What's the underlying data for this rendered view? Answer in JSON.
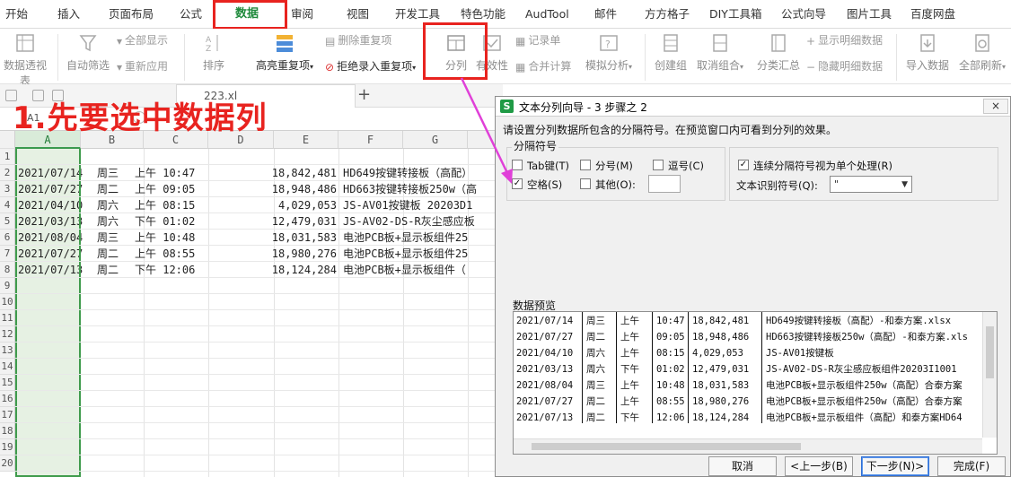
{
  "tabs": [
    "开始",
    "插入",
    "页面布局",
    "公式",
    "数据",
    "审阅",
    "视图",
    "开发工具",
    "特色功能",
    "AudTool",
    "邮件",
    "方方格子",
    "DIY工具箱",
    "公式向导",
    "图片工具",
    "百度网盘"
  ],
  "ribbon": {
    "pivot": "数据透视表",
    "autofilter": "自动筛选",
    "show_all": "全部显示",
    "reapply": "重新应用",
    "sort": "排序",
    "highlight_dup": "高亮重复项",
    "delete_dup": "删除重复项",
    "reject_dup": "拒绝录入重复项",
    "split": "分列",
    "validity": "有效性",
    "record": "记录单",
    "merge_calc": "合并计算",
    "simulate": "模拟分析",
    "create_group": "创建组",
    "ungroup": "取消组合",
    "subtotal": "分类汇总",
    "show_detail": "显示明细数据",
    "hide_detail": "隐藏明细数据",
    "import": "导入数据",
    "refresh_all": "全部刷新"
  },
  "quickbar": {
    "doc_name": "223.xl"
  },
  "namebox": "A1",
  "annotation": "1.先要选中数据列",
  "grid": {
    "columns": [
      "A",
      "B",
      "C",
      "D",
      "E",
      "F",
      "G"
    ],
    "rows": [
      "1",
      "2",
      "3",
      "4",
      "5",
      "6",
      "7",
      "8",
      "9",
      "10",
      "11",
      "12",
      "13",
      "14",
      "15",
      "16",
      "17",
      "18",
      "19",
      "20"
    ],
    "data": [
      [
        "2021/07/14",
        "周三",
        "上午 10:47",
        "18,842,481",
        "HD649按键转接板（高配）"
      ],
      [
        "2021/07/27",
        "周二",
        "上午 09:05",
        "18,948,486",
        "HD663按键转接板250w（高"
      ],
      [
        "2021/04/10",
        "周六",
        "上午 08:15",
        "4,029,053",
        "JS-AV01按键板   20203D1"
      ],
      [
        "2021/03/13",
        "周六",
        "下午 01:02",
        "12,479,031",
        "JS-AV02-DS-R灰尘感应板"
      ],
      [
        "2021/08/04",
        "周三",
        "上午 10:48",
        "18,031,583",
        "电池PCB板+显示板组件25"
      ],
      [
        "2021/07/27",
        "周二",
        "上午 08:55",
        "18,980,276",
        "电池PCB板+显示板组件25"
      ],
      [
        "2021/07/13",
        "周二",
        "下午 12:06",
        "18,124,284",
        "电池PCB板+显示板组件（"
      ]
    ]
  },
  "dialog": {
    "logo": "S",
    "title": "文本分列向导 - 3 步骤之 2",
    "close": "×",
    "instruction": "请设置分列数据所包含的分隔符号。在预览窗口内可看到分列的效果。",
    "group_label": "分隔符号",
    "tab": "Tab键(T)",
    "semicolon": "分号(M)",
    "comma": "逗号(C)",
    "space": "空格(S)",
    "other": "其他(O):",
    "consecutive": "连续分隔符号视为单个处理(R)",
    "text_qualifier_label": "文本识别符号(Q):",
    "text_qualifier_value": "\"",
    "preview_label": "数据预览",
    "preview_rows": [
      [
        "2021/07/14",
        "周三",
        "上午",
        "10:47",
        "18,842,481",
        "HD649按键转接板（高配）-和泰方案.xlsx"
      ],
      [
        "2021/07/27",
        "周二",
        "上午",
        "09:05",
        "18,948,486",
        "HD663按键转接板250w（高配）-和泰方案.xls"
      ],
      [
        "2021/04/10",
        "周六",
        "上午",
        "08:15",
        "4,029,053",
        "JS-AV01按键板"
      ],
      [
        "2021/03/13",
        "周六",
        "下午",
        "01:02",
        "12,479,031",
        "JS-AV02-DS-R灰尘感应板组件20203I1001"
      ],
      [
        "2021/08/04",
        "周三",
        "上午",
        "10:48",
        "18,031,583",
        "电池PCB板+显示板组件250w（高配）合泰方案"
      ],
      [
        "2021/07/27",
        "周二",
        "上午",
        "08:55",
        "18,980,276",
        "电池PCB板+显示板组件250w（高配）合泰方案"
      ],
      [
        "2021/07/13",
        "周二",
        "下午",
        "12:06",
        "18,124,284",
        "电池PCB板+显示板组件（高配）和泰方案HD64"
      ]
    ],
    "buttons": {
      "cancel": "取消",
      "back": "<上一步(B)",
      "next": "下一步(N)>",
      "finish": "完成(F)"
    }
  },
  "colors": {
    "accent": "#1f8a3c",
    "annotation": "#e8231f",
    "selection": "#e6f1e3"
  }
}
